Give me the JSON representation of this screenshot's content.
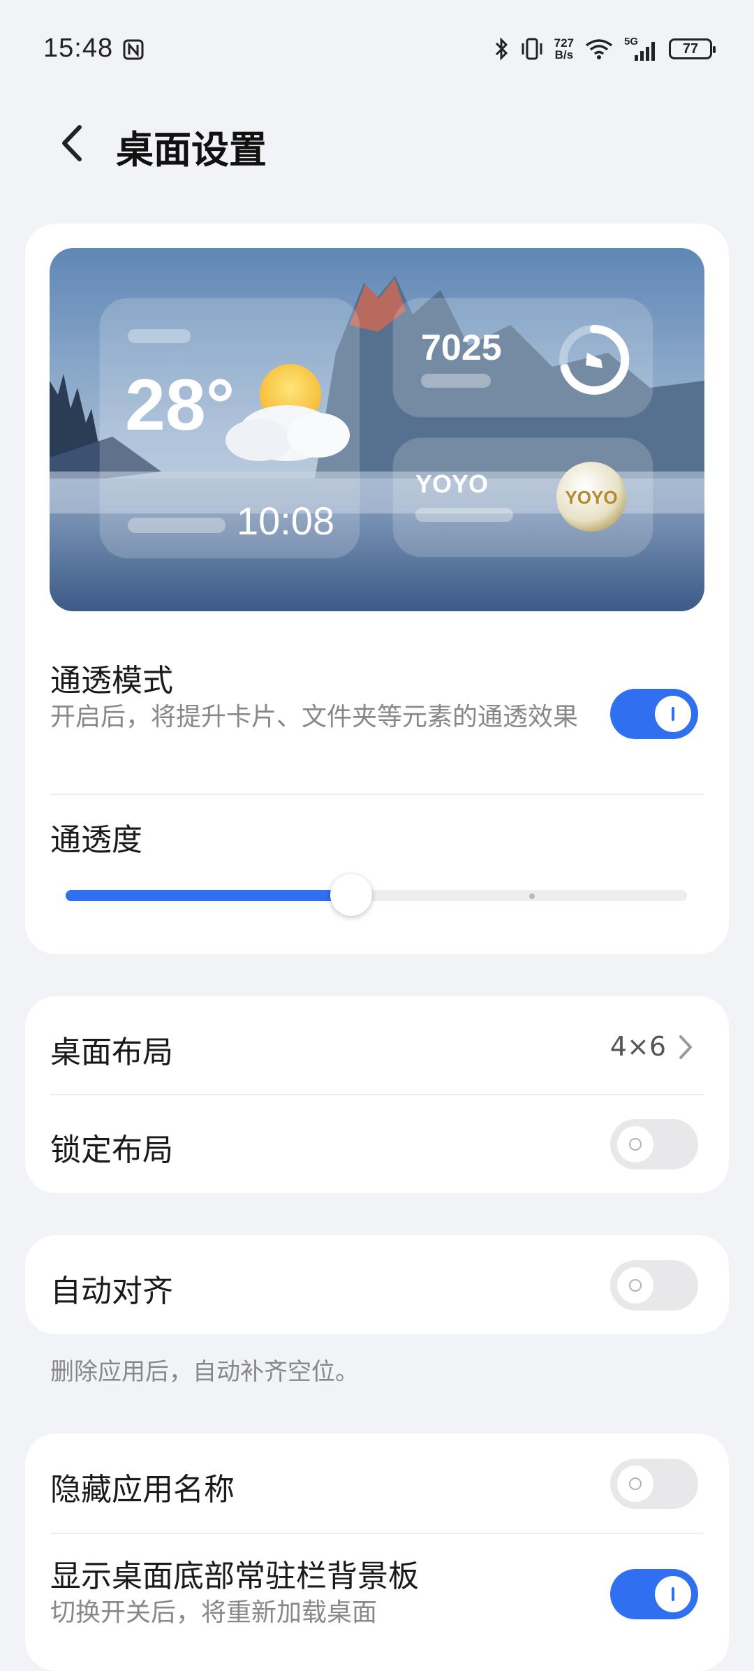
{
  "status_bar": {
    "time": "15:48",
    "net_speed_top": "727",
    "net_speed_bottom": "B/s",
    "network": "5G",
    "battery": "77",
    "icons": [
      "nfc-icon",
      "bluetooth-icon",
      "vibrate-icon",
      "wifi-icon",
      "signal-icon",
      "battery-icon"
    ]
  },
  "header": {
    "title": "桌面设置"
  },
  "preview": {
    "weather_temp": "28°",
    "weather_time": "10:08",
    "steps": "7025",
    "yoyo_label": "YOYO",
    "yoyo_badge": "YOYO"
  },
  "transparency": {
    "title": "通透模式",
    "description": "开启后，将提升卡片、文件夹等元素的通透效果",
    "enabled": true,
    "level_label": "通透度",
    "level_value": 0.46
  },
  "layout": {
    "desktop_layout_label": "桌面布局",
    "desktop_layout_value": "4×6",
    "lock_layout_label": "锁定布局",
    "lock_layout_enabled": false
  },
  "align": {
    "label": "自动对齐",
    "enabled": false,
    "hint": "删除应用后，自动补齐空位。"
  },
  "misc": {
    "hide_app_name_label": "隐藏应用名称",
    "hide_app_name_enabled": false,
    "dock_bg_label": "显示桌面底部常驻栏背景板",
    "dock_bg_description": "切换开关后，将重新加载桌面",
    "dock_bg_enabled": true
  },
  "colors": {
    "accent": "#2f6ff0",
    "background": "#f2f3f7",
    "card": "#ffffff"
  }
}
